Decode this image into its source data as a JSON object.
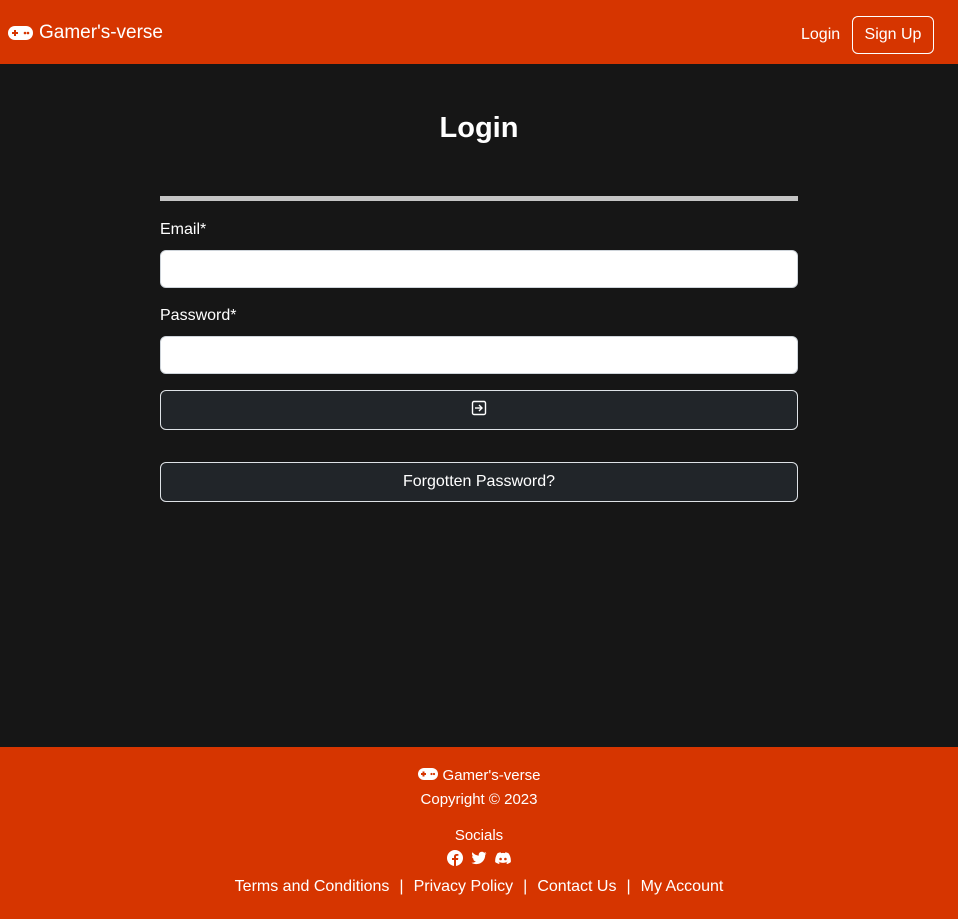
{
  "navbar": {
    "brand": "Gamer's-verse",
    "login_label": "Login",
    "signup_label": "Sign Up"
  },
  "main": {
    "title": "Login",
    "email_label": "Email*",
    "email_value": "",
    "password_label": "Password*",
    "password_value": "",
    "submit_icon": "box-arrow-in-right-icon",
    "forgot_label": "Forgotten Password?"
  },
  "footer": {
    "brand": "Gamer's-verse",
    "copyright": "Copyright © 2023",
    "socials_label": "Socials",
    "social_icons": [
      "facebook-icon",
      "twitter-icon",
      "discord-icon"
    ],
    "links": [
      "Terms and Conditions",
      "Privacy Policy",
      "Contact Us",
      "My Account"
    ],
    "separator": "|"
  },
  "colors": {
    "accent": "#d63500",
    "background": "#161616",
    "button_dark": "#212529",
    "divider": "#c4c4c4"
  }
}
